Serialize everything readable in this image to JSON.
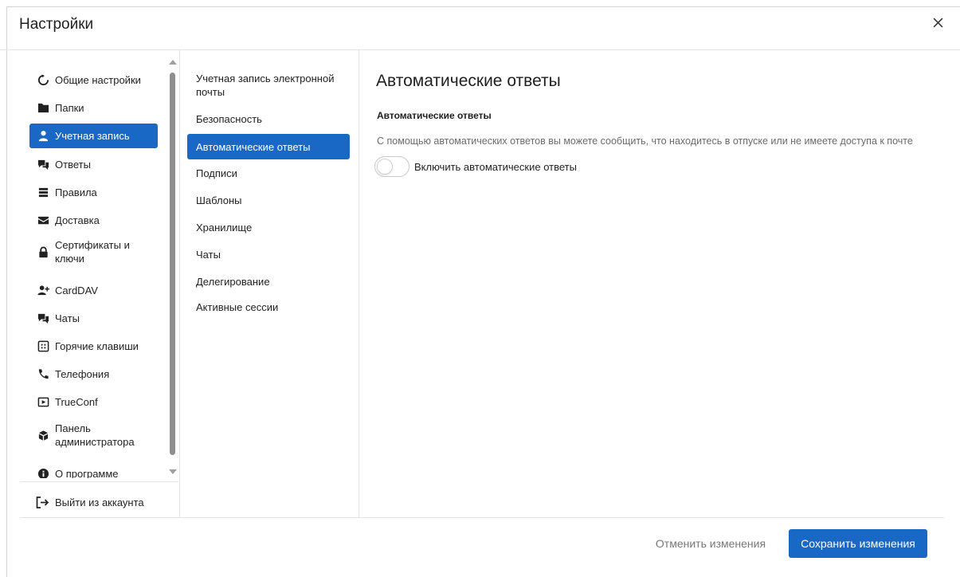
{
  "dialog": {
    "title": "Настройки"
  },
  "left_nav": {
    "items": [
      {
        "label": "Общие настройки",
        "icon": "refresh-icon"
      },
      {
        "label": "Папки",
        "icon": "folder-icon"
      },
      {
        "label": "Учетная запись",
        "icon": "user-icon",
        "active": true
      },
      {
        "label": "Ответы",
        "icon": "reply-chat-icon"
      },
      {
        "label": "Правила",
        "icon": "rules-list-icon"
      },
      {
        "label": "Доставка",
        "icon": "envelope-icon"
      },
      {
        "label": "Сертификаты и ключи",
        "icon": "lock-icon"
      },
      {
        "label": "CardDAV",
        "icon": "add-user-icon"
      },
      {
        "label": "Чаты",
        "icon": "chat-icon"
      },
      {
        "label": "Горячие клавиши",
        "icon": "keyboard-icon"
      },
      {
        "label": "Телефония",
        "icon": "phone-icon"
      },
      {
        "label": "TrueConf",
        "icon": "video-icon"
      },
      {
        "label": "Панель администратора",
        "icon": "admin-cube-icon"
      },
      {
        "label": "О программе",
        "icon": "info-icon"
      }
    ],
    "logout_label": "Выйти из аккаунта"
  },
  "sub_nav": {
    "items": [
      {
        "label": "Учетная запись электронной почты"
      },
      {
        "label": "Безопасность"
      },
      {
        "label": "Автоматические ответы",
        "active": true
      },
      {
        "label": "Подписи"
      },
      {
        "label": "Шаблоны"
      },
      {
        "label": "Хранилище"
      },
      {
        "label": "Чаты"
      },
      {
        "label": "Делегирование"
      },
      {
        "label": "Активные сессии"
      }
    ]
  },
  "content": {
    "title": "Автоматические ответы",
    "section_title": "Автоматические ответы",
    "description": "С помощью автоматических ответов вы можете сообщить, что находитесь в отпуске или не имеете доступа к почте",
    "toggle_label": "Включить автоматические ответы",
    "toggle_on": false
  },
  "footer": {
    "cancel_label": "Отменить изменения",
    "save_label": "Сохранить изменения"
  },
  "colors": {
    "accent": "#1968c6"
  }
}
